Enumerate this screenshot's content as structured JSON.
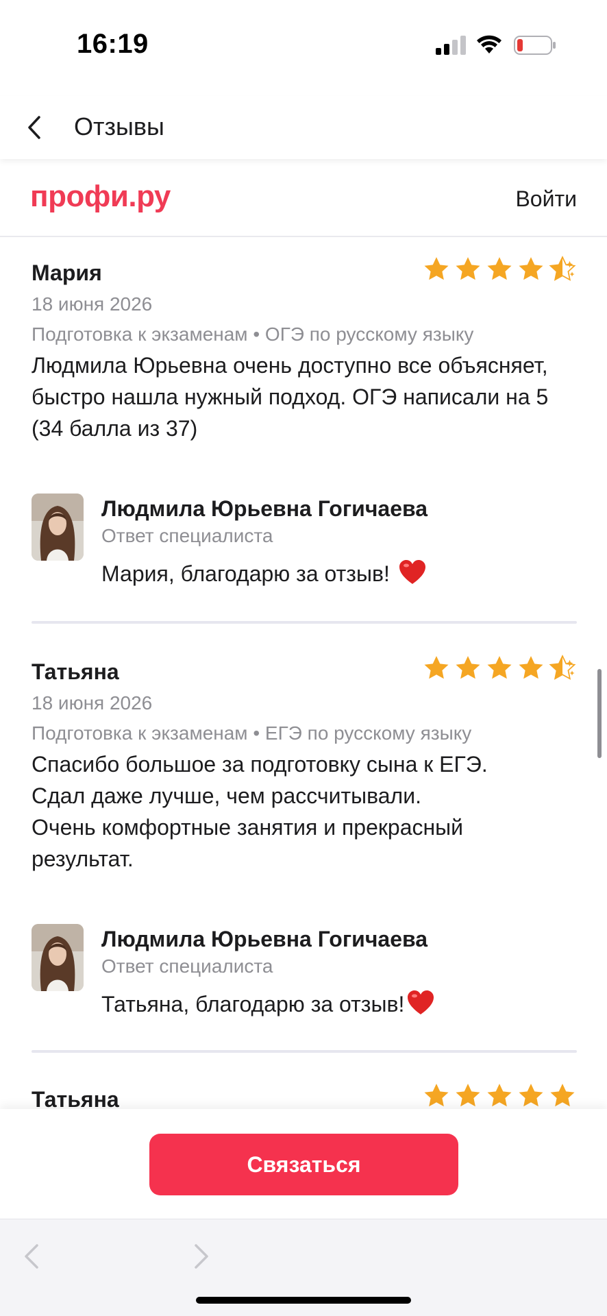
{
  "status_bar": {
    "time": "16:19",
    "battery_color": "#e53935"
  },
  "navbar": {
    "title": "Отзывы"
  },
  "site_header": {
    "logo": "профи.ру",
    "login_label": "Войти"
  },
  "reviews": [
    {
      "author": "Мария",
      "rating": 4.5,
      "date": "18 июня 2026",
      "category": "Подготовка к экзаменам • ОГЭ по русскому языку",
      "text": "Людмила Юрьевна очень доступно все объясняет, быстро нашла нужный подход. ОГЭ написали на 5 (34 балла из 37)",
      "reply": {
        "name": "Людмила Юрьевна Гогичаева",
        "role": "Ответ специалиста",
        "text": "Мария, благодарю за отзыв! ",
        "emoji": "red-heart"
      }
    },
    {
      "author": "Татьяна",
      "rating": 4.5,
      "date": "18 июня 2026",
      "category": "Подготовка к экзаменам • ЕГЭ по русскому языку",
      "text_lines": [
        "Спасибо большое за подготовку сына к ЕГЭ.",
        "Сдал даже лучше, чем рассчитывали.",
        "Очень комфортные занятия и прекрасный",
        "результат."
      ],
      "reply": {
        "name": "Людмила Юрьевна Гогичаева",
        "role": "Ответ специалиста",
        "text": "Татьяна, благодарю за отзыв!",
        "emoji": "red-heart"
      }
    },
    {
      "author": "Татьяна",
      "rating": 5
    }
  ],
  "cta": {
    "label": "Связаться"
  },
  "colors": {
    "accent": "#f5324e",
    "star": "#f5a623",
    "logo": "#f03b55",
    "muted": "#8e8e93"
  }
}
